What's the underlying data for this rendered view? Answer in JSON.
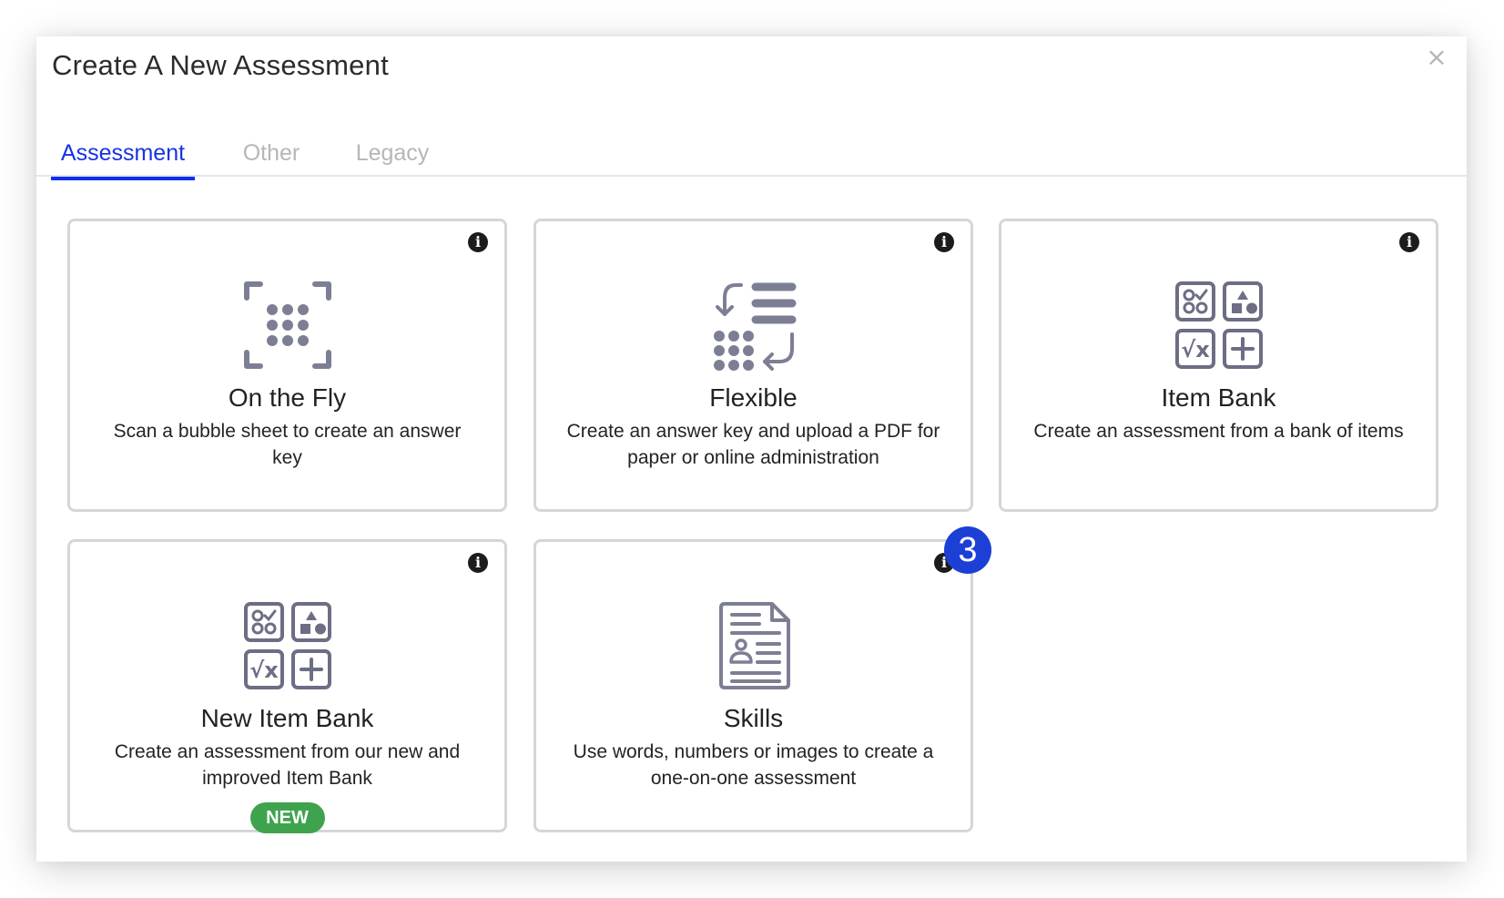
{
  "dialog": {
    "title": "Create A New Assessment",
    "close_icon": "close-icon",
    "close_glyph": "×"
  },
  "tabs": [
    {
      "label": "Assessment",
      "active": true
    },
    {
      "label": "Other",
      "active": false
    },
    {
      "label": "Legacy",
      "active": false
    }
  ],
  "cards": [
    {
      "name": "On the Fly",
      "description": "Scan a bubble sheet to create an answer key",
      "icon": "scan-bubble-icon",
      "info_glyph": "i"
    },
    {
      "name": "Flexible",
      "description": "Create an answer key and upload a PDF for paper or online administration",
      "icon": "flexible-sync-icon",
      "info_glyph": "i"
    },
    {
      "name": "Item Bank",
      "description": "Create an assessment from a bank of items",
      "icon": "item-bank-icon",
      "info_glyph": "i"
    },
    {
      "name": "New Item Bank",
      "description": "Create an assessment from our new and improved Item Bank",
      "icon": "item-bank-icon",
      "info_glyph": "i",
      "badge": "NEW"
    },
    {
      "name": "Skills",
      "description": "Use words, numbers or images to create a one-on-one assessment",
      "icon": "skills-document-icon",
      "info_glyph": "i"
    }
  ],
  "step_marker": "3",
  "colors": {
    "accent": "#0a2ef2",
    "inactive_tab": "#b8b6b8",
    "icon_gray": "#7c7f94",
    "new_badge": "#3fa34d",
    "step_marker": "#1c3fd6"
  }
}
